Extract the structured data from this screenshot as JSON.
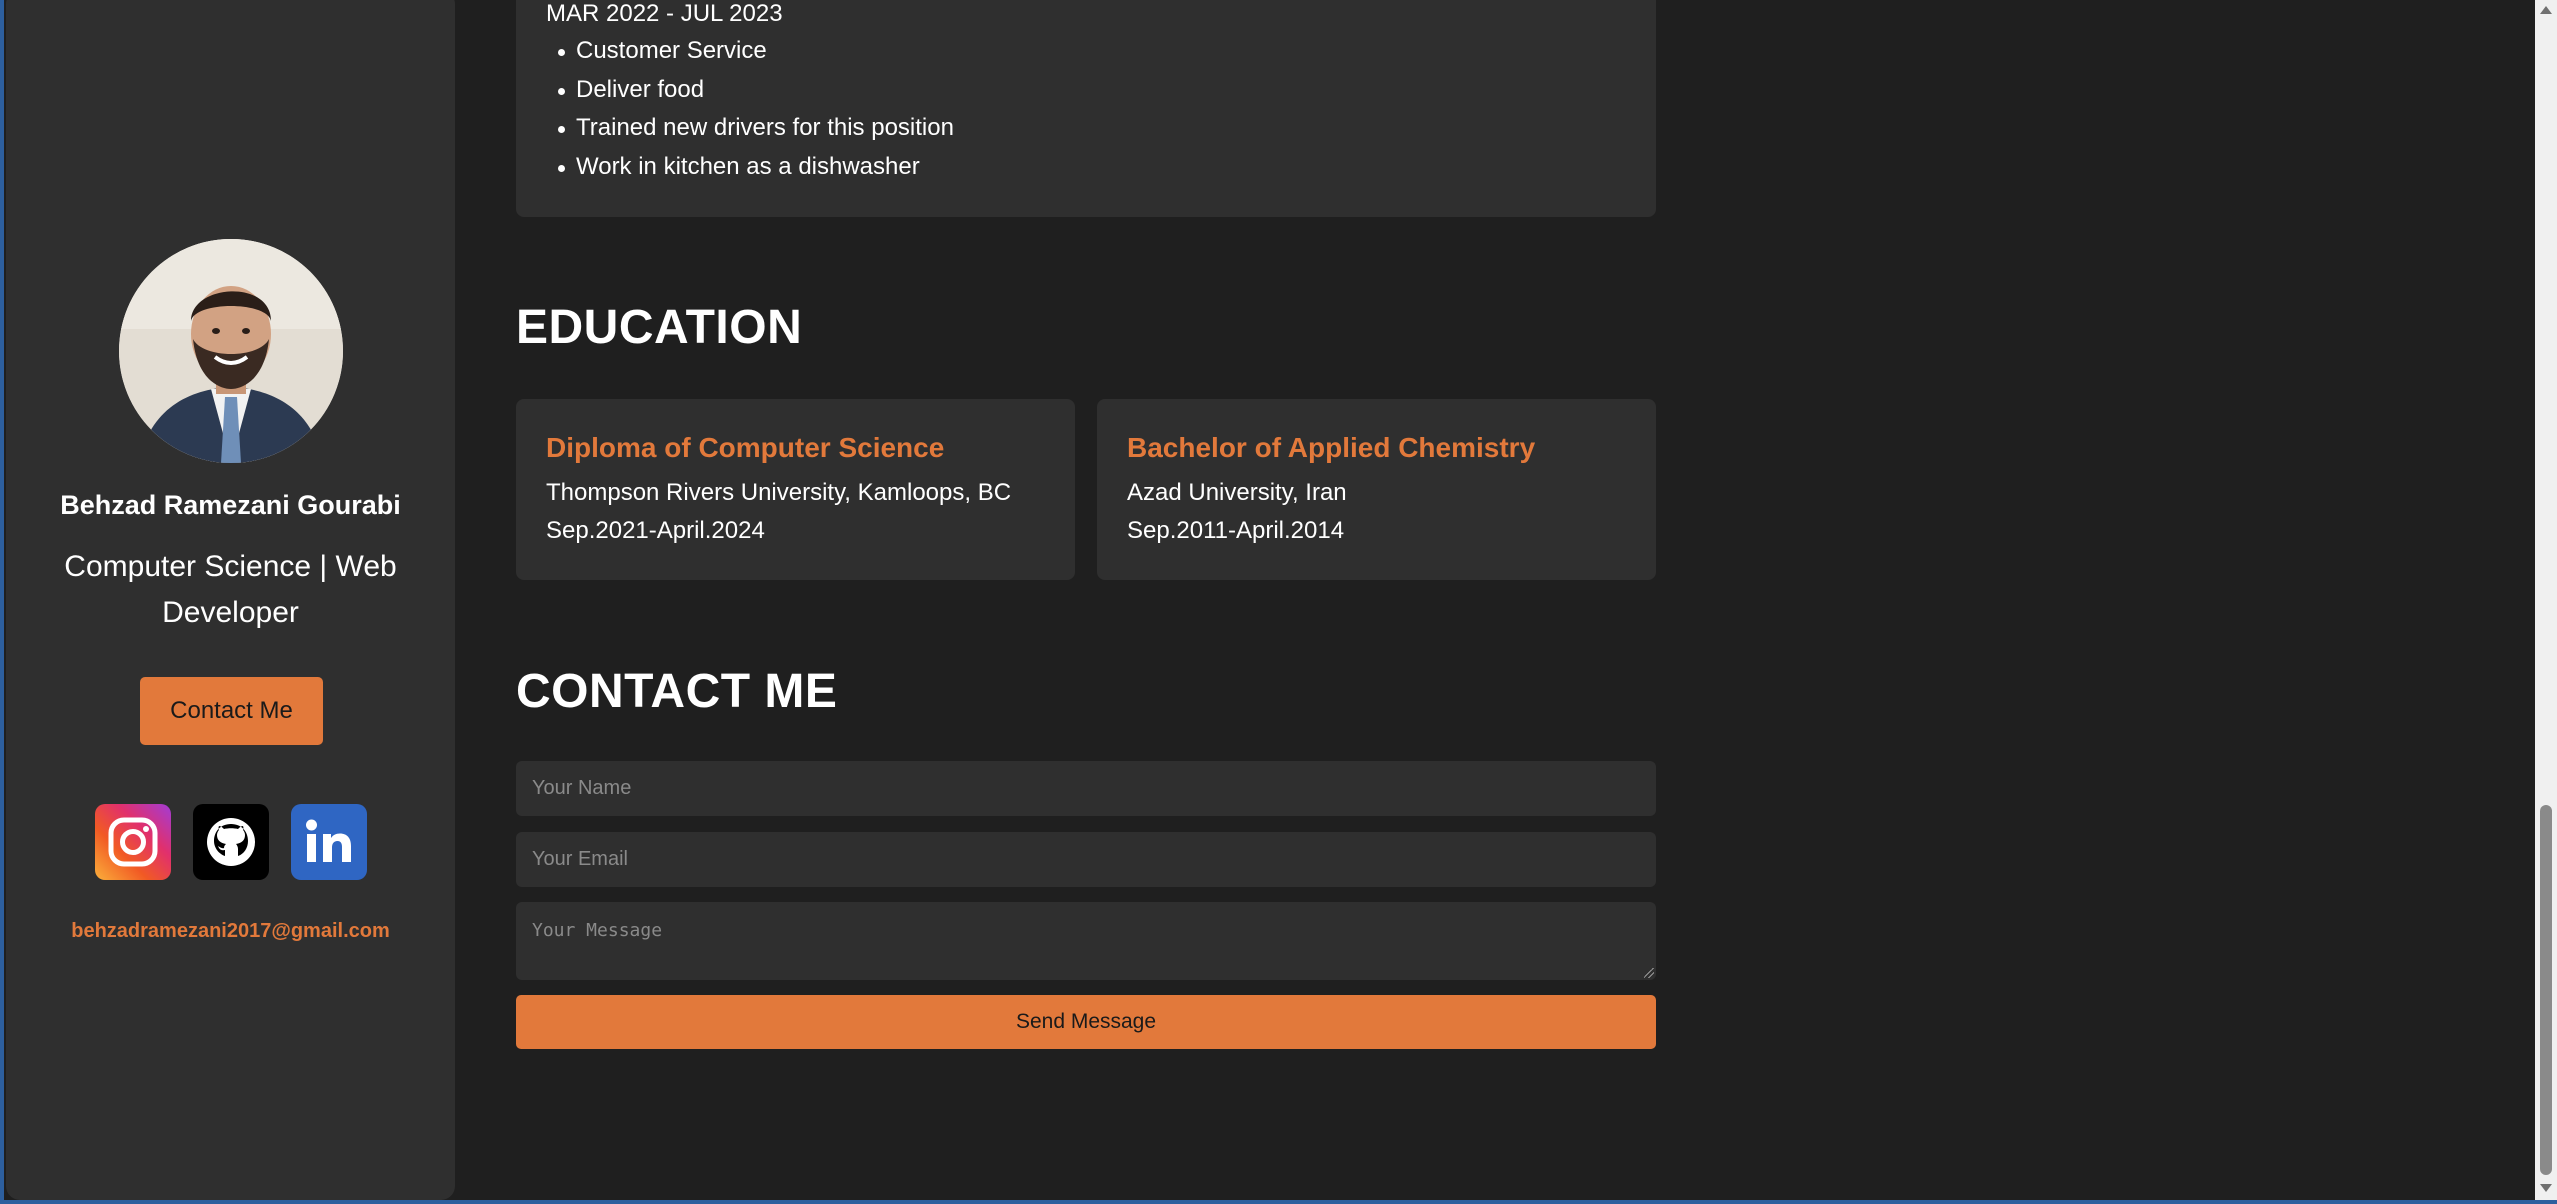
{
  "sidebar": {
    "name": "Behzad Ramezani Gourabi",
    "role": "Computer Science | Web Developer",
    "contact_button": "Contact Me",
    "social": [
      {
        "name": "instagram-icon"
      },
      {
        "name": "github-icon"
      },
      {
        "name": "linkedin-icon"
      }
    ],
    "email": "behzadramezani2017@gmail.com"
  },
  "experience": {
    "dates": "MAR 2022 - JUL 2023",
    "duties": [
      "Customer Service",
      "Deliver food",
      "Trained new drivers for this position",
      "Work in kitchen as a dishwasher"
    ]
  },
  "education": {
    "title": "EDUCATION",
    "items": [
      {
        "degree": "Diploma of Computer Science",
        "school": "Thompson Rivers University, Kamloops, BC",
        "dates": "Sep.2021-April.2024"
      },
      {
        "degree": "Bachelor of Applied Chemistry",
        "school": "Azad University, Iran",
        "dates": "Sep.2011-April.2014"
      }
    ]
  },
  "contact": {
    "title": "CONTACT ME",
    "name_placeholder": "Your Name",
    "email_placeholder": "Your Email",
    "message_placeholder": "Your Message",
    "send_label": "Send Message"
  },
  "colors": {
    "accent": "#e2793b",
    "background": "#1f1f1f",
    "card": "#2f2f2f"
  }
}
